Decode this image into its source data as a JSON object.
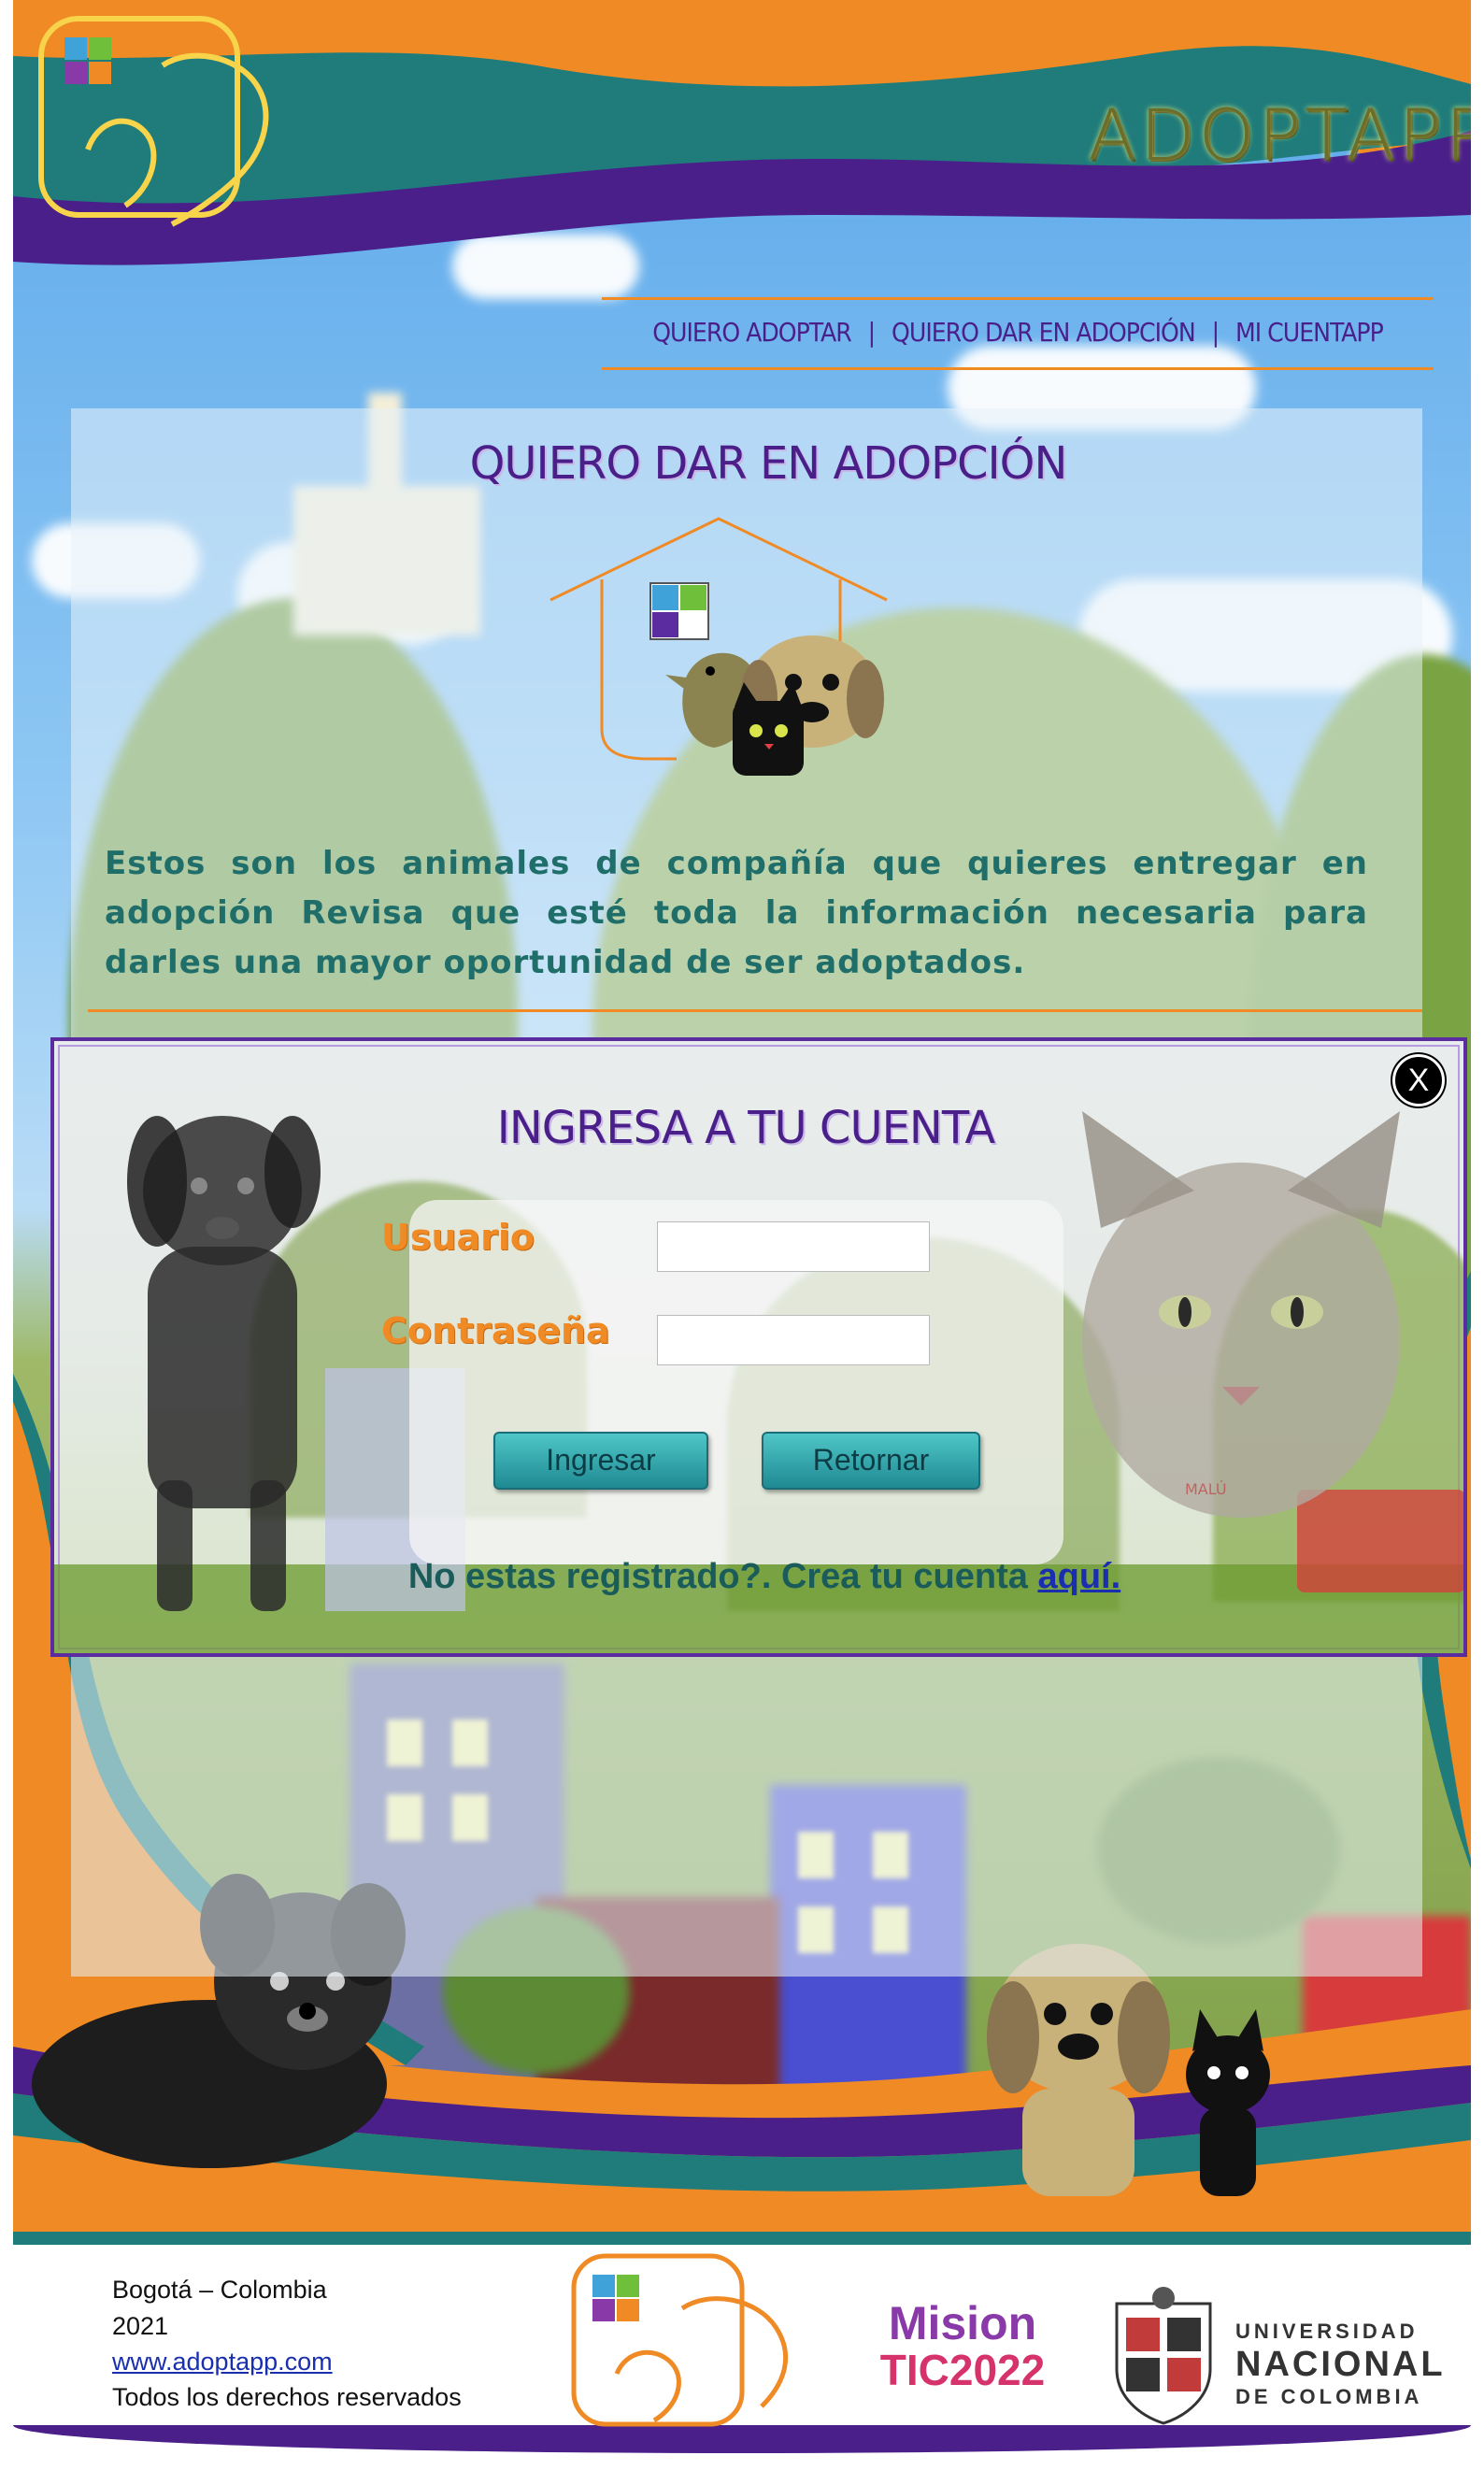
{
  "header": {
    "brand": "ADOPTAPP"
  },
  "nav": {
    "items": [
      "QUIERO ADOPTAR",
      "QUIERO DAR EN ADOPCIÓN",
      "MI CUENTAPP"
    ],
    "separator": "|"
  },
  "section": {
    "title": "QUIERO DAR EN ADOPCIÓN",
    "description": "Estos son los animales de compañía que quieres entregar en adopción Revisa que esté toda la información necesaria para darles una mayor oportunidad de ser adoptados."
  },
  "login_modal": {
    "title": "INGRESA A TU CUENTA",
    "close_label": "X",
    "user_label": "Usuario",
    "password_label": "Contraseña",
    "user_value": "",
    "password_value": "",
    "login_button": "Ingresar",
    "return_button": "Retornar",
    "register_text": "No estas registrado?. Crea tu cuenta ",
    "register_link": "aquí.",
    "cat_tag": "MALÚ"
  },
  "footer": {
    "city": "Bogotá – Colombia",
    "year": "2021",
    "website": "www.adoptapp.com",
    "rights": "Todos los derechos reservados",
    "mision_line1": "Mision",
    "mision_line2": "TIC2022",
    "university_line1": "UNIVERSIDAD",
    "university_line2": "NACIONAL",
    "university_line3": "DE COLOMBIA"
  },
  "colors": {
    "purple": "#4a1f8a",
    "orange": "#f08a24",
    "teal": "#1f6e6a",
    "button": "#2aa5ab"
  }
}
